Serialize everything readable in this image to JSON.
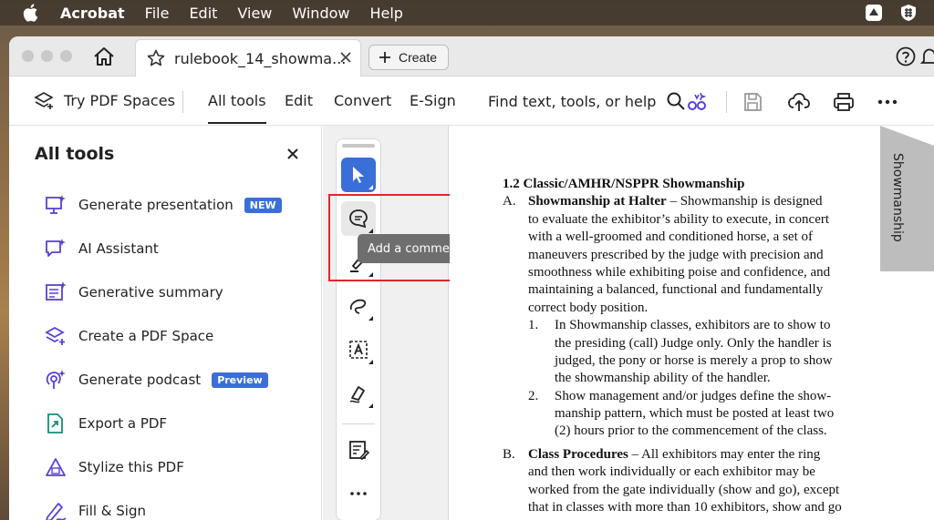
{
  "menubar": {
    "app": "Acrobat",
    "items": [
      "File",
      "Edit",
      "View",
      "Window",
      "Help"
    ]
  },
  "tabbar": {
    "doc_title": "rulebook_14_showma...",
    "create_label": "Create"
  },
  "toolbar": {
    "try_label": "Try PDF Spaces",
    "tabs": [
      "All tools",
      "Edit",
      "Convert",
      "E-Sign"
    ],
    "search_label": "Find text, tools, or help"
  },
  "panel": {
    "title": "All tools",
    "tools": [
      {
        "label": "Generate presentation",
        "badge": "NEW",
        "icon": "presentation-icon"
      },
      {
        "label": "AI Assistant",
        "icon": "ai-assistant-icon"
      },
      {
        "label": "Generative summary",
        "icon": "summary-icon"
      },
      {
        "label": "Create a PDF Space",
        "icon": "pdf-space-icon"
      },
      {
        "label": "Generate podcast",
        "badge": "Preview",
        "icon": "podcast-icon"
      },
      {
        "label": "Export a PDF",
        "icon": "export-icon"
      },
      {
        "label": "Stylize this PDF",
        "icon": "stylize-icon"
      },
      {
        "label": "Fill & Sign",
        "icon": "fill-sign-icon"
      }
    ]
  },
  "tooltip": "Add a comment",
  "document": {
    "bookmark": "Showmanship",
    "lines": [
      {
        "text": "1.2  Classic/AMHR/NSPPR Showmanship",
        "bold": true,
        "indent": 0
      },
      {
        "lead": "A.",
        "boldpart": "Showmanship at Halter",
        "text": " – Showmanship is designed",
        "indent": 28
      },
      {
        "text": "to evaluate the exhibitor’s ability to execute, in concert",
        "indent": 28
      },
      {
        "text": "with a well-groomed and conditioned horse, a set of",
        "indent": 28
      },
      {
        "text": "maneuvers prescribed by the judge with precision and",
        "indent": 28
      },
      {
        "text": "smoothness while exhibiting poise and confidence, and",
        "indent": 28
      },
      {
        "text": "maintaining a balanced, functional and fundamentally",
        "indent": 28
      },
      {
        "text": "correct body position.",
        "indent": 28
      },
      {
        "lead": "1.",
        "text": "In Showmanship classes, exhibitors are to show to",
        "indent": 57,
        "leadindent": 28
      },
      {
        "text": "the presiding (call) Judge only. Only the handler is",
        "indent": 57
      },
      {
        "text": "judged, the pony or horse is merely a prop to show",
        "indent": 57
      },
      {
        "text": "the showmanship ability of the handler.",
        "indent": 57
      },
      {
        "lead": "2.",
        "text": "Show management and/or judges define the show-",
        "indent": 57,
        "leadindent": 28
      },
      {
        "text": "manship pattern, which must be posted at least two",
        "indent": 57
      },
      {
        "text": "(2) hours prior to the commencement of the class.",
        "indent": 57
      },
      {
        "lead": "B.",
        "boldpart": "Class Procedures",
        "text": " – All exhibitors may enter the ring",
        "indent": 28,
        "gap": 6
      },
      {
        "text": "and then work individually or each exhibitor may be",
        "indent": 28
      },
      {
        "text": "worked from the gate individually (show and go), except",
        "indent": 28
      },
      {
        "text": "that in classes with more than 10 exhibitors, show and go",
        "indent": 28
      }
    ]
  }
}
